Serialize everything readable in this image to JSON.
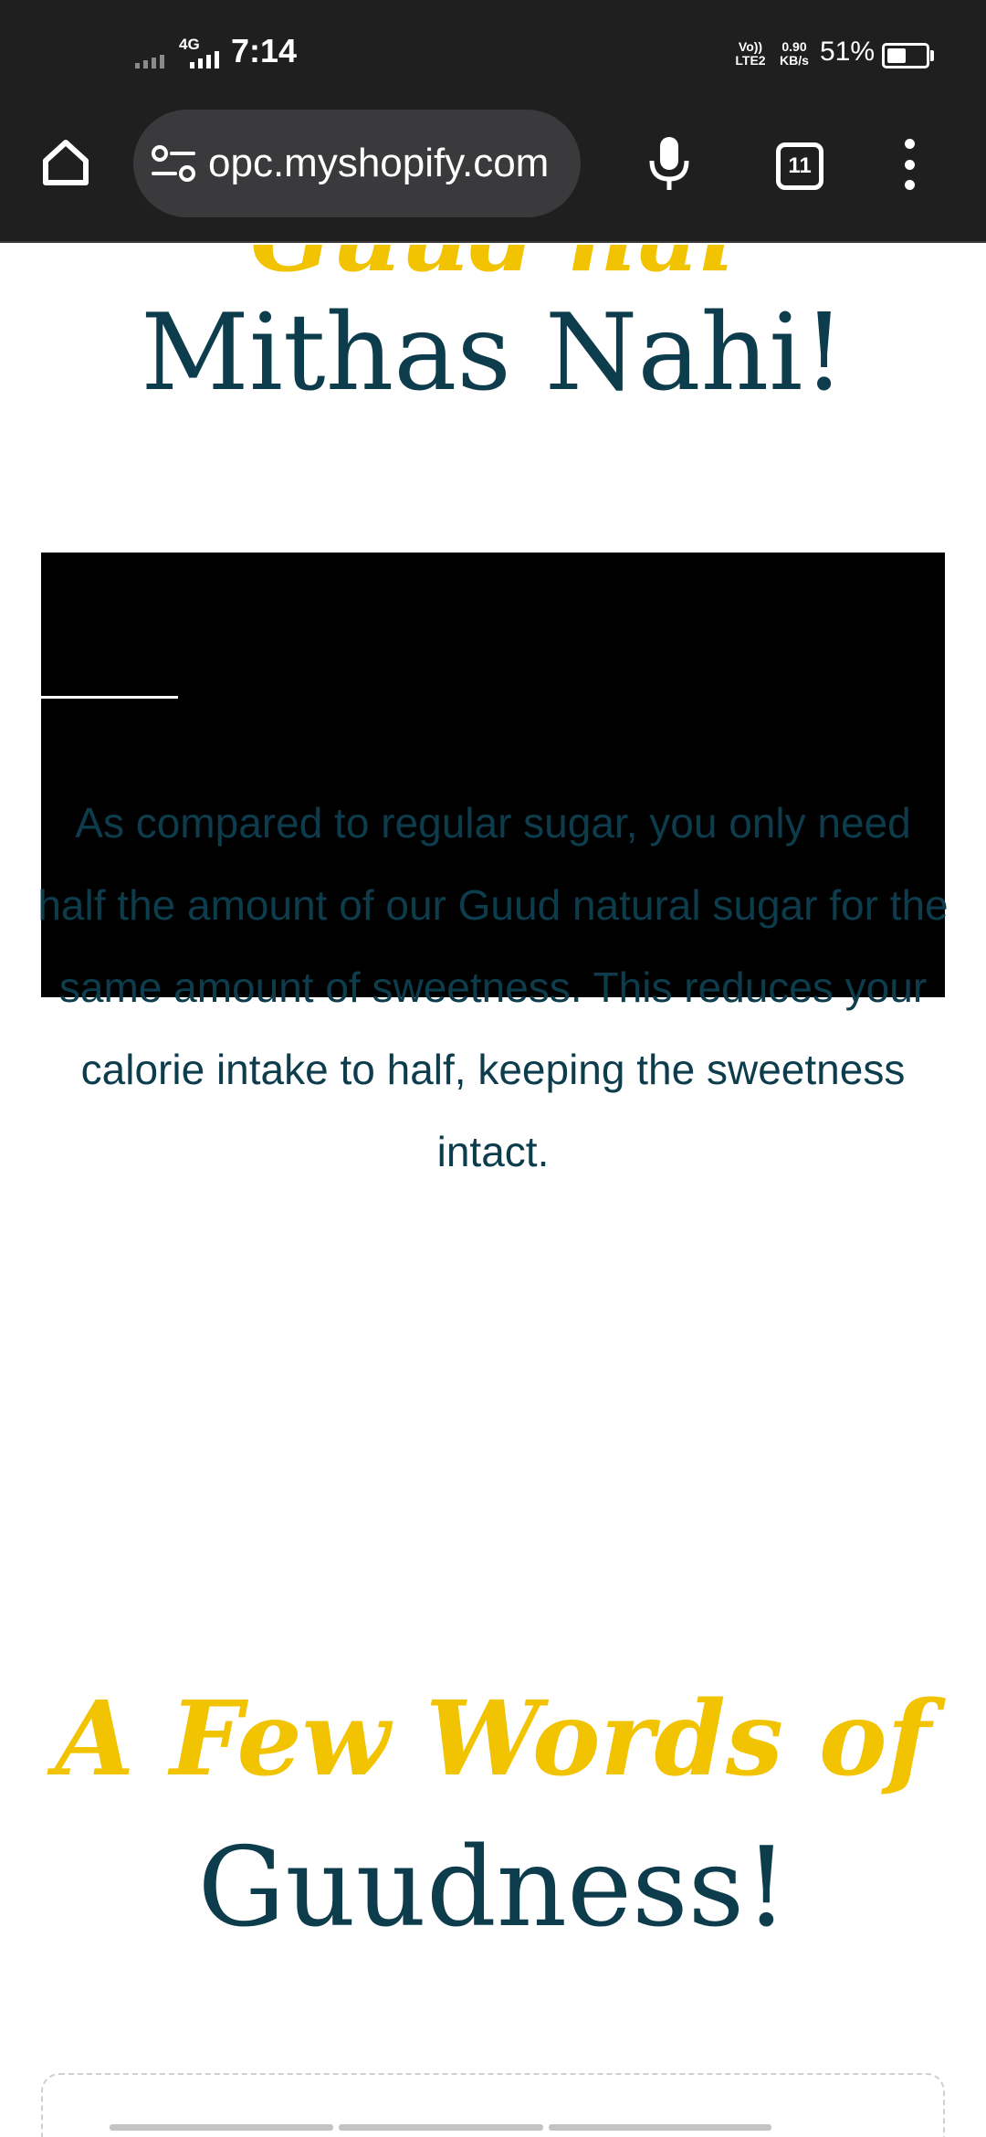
{
  "status_bar": {
    "network_type": "4G",
    "time": "7:14",
    "volte_line1": "Vo))",
    "volte_line2": "LTE2",
    "speed_value": "0.90",
    "speed_unit": "KB/s",
    "battery_percent_text": "51%",
    "battery_level": 0.51
  },
  "toolbar": {
    "url": "opc.myshopify.com",
    "tab_count": "11"
  },
  "page": {
    "headline_script_partial": "Guud hai Guudness,",
    "headline_main": "Mithas Nahi!",
    "body_text": "As compared to regular sugar, you only need half the amount of our Guud natural sugar for the same amount of sweetness. This reduces your calorie intake to half, keeping the sweetness intact.",
    "section_script": "A Few Words of",
    "section_main": "Guudness!"
  },
  "colors": {
    "brand_dark": "#0d3c4c",
    "brand_yellow": "#f2c300",
    "chrome_bg": "#1f1f1f",
    "url_pill_bg": "#3a3a3c"
  }
}
